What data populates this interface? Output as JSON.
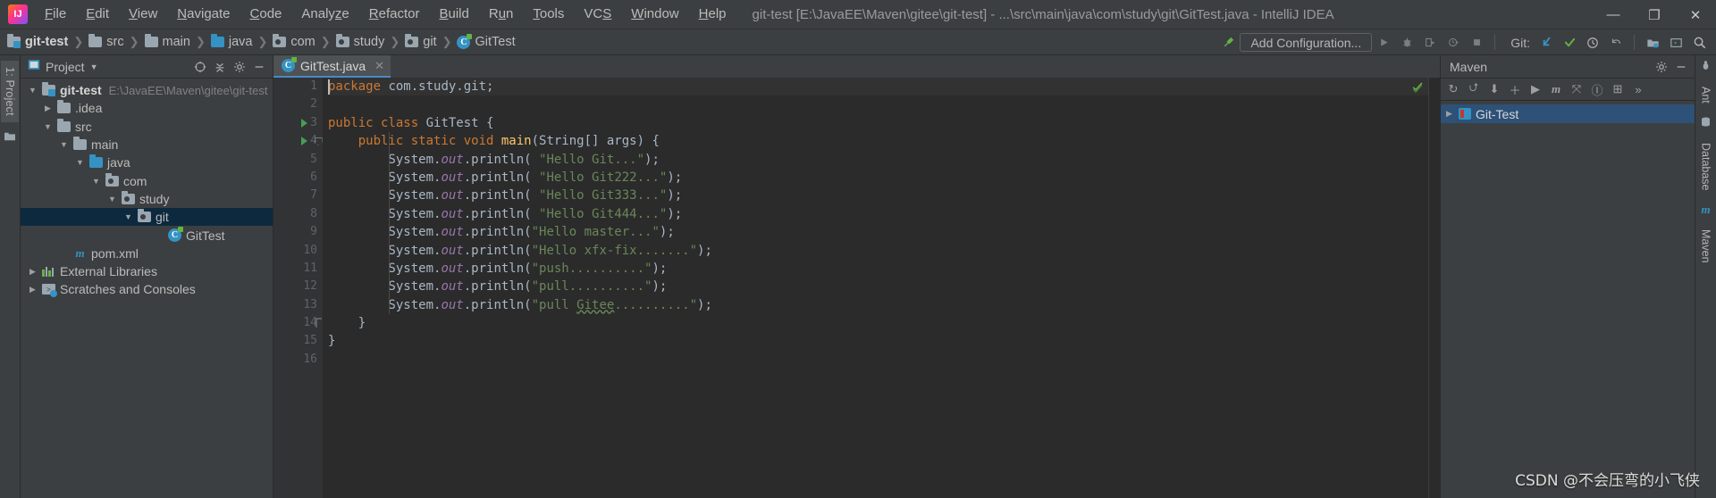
{
  "window": {
    "title": "git-test [E:\\JavaEE\\Maven\\gitee\\git-test] - ...\\src\\main\\java\\com\\study\\git\\GitTest.java - IntelliJ IDEA",
    "logo_text": "IJ",
    "minimize": "—",
    "maximize": "❐",
    "close": "✕"
  },
  "menu": {
    "items": [
      {
        "label": "File"
      },
      {
        "label": "Edit"
      },
      {
        "label": "View"
      },
      {
        "label": "Navigate"
      },
      {
        "label": "Code"
      },
      {
        "label": "Analyze"
      },
      {
        "label": "Refactor"
      },
      {
        "label": "Build"
      },
      {
        "label": "Run"
      },
      {
        "label": "Tools"
      },
      {
        "label": "VCS"
      },
      {
        "label": "Window"
      },
      {
        "label": "Help"
      }
    ]
  },
  "navbar": {
    "breadcrumbs": [
      {
        "label": "git-test",
        "icon": "module-folder-icon"
      },
      {
        "label": "src",
        "icon": "folder-icon"
      },
      {
        "label": "main",
        "icon": "folder-icon"
      },
      {
        "label": "java",
        "icon": "source-folder-icon"
      },
      {
        "label": "com",
        "icon": "package-icon"
      },
      {
        "label": "study",
        "icon": "package-icon"
      },
      {
        "label": "git",
        "icon": "package-icon"
      },
      {
        "label": "GitTest",
        "icon": "java-class-icon"
      }
    ],
    "separator": "❯",
    "build_icon": "hammer-icon",
    "add_configuration": "Add Configuration...",
    "run_icon": "run-icon",
    "debug_icon": "debug-icon",
    "run_coverage_icon": "run-with-coverage-icon",
    "profile_icon": "profiler-icon",
    "stop_icon": "stop-icon",
    "git_label": "Git:",
    "git_update_icon": "update-project-icon",
    "git_commit_icon": "commit-icon",
    "git_history_icon": "history-icon",
    "git_rollback_icon": "rollback-icon",
    "project_structure_icon": "project-structure-icon",
    "terminal_icon": "terminal-icon",
    "search_icon": "search-everywhere-icon"
  },
  "left_rail": {
    "project_tab": "1: Project",
    "structure_icon": "structure-icon"
  },
  "project_panel": {
    "title": "Project",
    "dropdown_icon": "chevron-down-icon",
    "window_icon": "project-view-icon",
    "locate_icon": "scroll-from-source-icon",
    "collapse_icon": "collapse-all-icon",
    "settings_icon": "gear-icon",
    "hide_icon": "hide-icon",
    "tree": [
      {
        "label": "git-test",
        "hint": "E:\\JavaEE\\Maven\\gitee\\git-test",
        "depth": 0,
        "arrow": "▼",
        "icon": "module-folder-icon",
        "bold": true,
        "selected": false
      },
      {
        "label": ".idea",
        "hint": "",
        "depth": 1,
        "arrow": "▶",
        "icon": "folder-icon",
        "bold": false,
        "selected": false
      },
      {
        "label": "src",
        "hint": "",
        "depth": 1,
        "arrow": "▼",
        "icon": "folder-icon",
        "bold": false,
        "selected": false
      },
      {
        "label": "main",
        "hint": "",
        "depth": 2,
        "arrow": "▼",
        "icon": "folder-icon",
        "bold": false,
        "selected": false
      },
      {
        "label": "java",
        "hint": "",
        "depth": 3,
        "arrow": "▼",
        "icon": "source-folder-icon",
        "bold": false,
        "selected": false
      },
      {
        "label": "com",
        "hint": "",
        "depth": 4,
        "arrow": "▼",
        "icon": "package-icon",
        "bold": false,
        "selected": false
      },
      {
        "label": "study",
        "hint": "",
        "depth": 5,
        "arrow": "▼",
        "icon": "package-icon",
        "bold": false,
        "selected": false
      },
      {
        "label": "git",
        "hint": "",
        "depth": 6,
        "arrow": "▼",
        "icon": "package-icon",
        "bold": false,
        "selected": true
      },
      {
        "label": "GitTest",
        "hint": "",
        "depth": 7,
        "arrow": "",
        "icon": "java-class-icon",
        "bold": false,
        "selected": false
      },
      {
        "label": "pom.xml",
        "hint": "",
        "depth": 2,
        "arrow": "",
        "icon": "maven-file-icon",
        "bold": false,
        "selected": false
      },
      {
        "label": "External Libraries",
        "hint": "",
        "depth": 0,
        "arrow": "▶",
        "icon": "libraries-icon",
        "bold": false,
        "selected": false
      },
      {
        "label": "Scratches and Consoles",
        "hint": "",
        "depth": 0,
        "arrow": "▶",
        "icon": "scratches-icon",
        "bold": false,
        "selected": false
      }
    ]
  },
  "editor": {
    "tab": {
      "label": "GitTest.java",
      "icon": "java-class-icon",
      "close": "✕"
    },
    "inspection_icon": "inspections-ok-icon",
    "lines": [
      {
        "n": "1",
        "mark": "",
        "current": true
      },
      {
        "n": "2",
        "mark": "",
        "current": false
      },
      {
        "n": "3",
        "mark": "run",
        "current": false
      },
      {
        "n": "4",
        "mark": "run-fold",
        "current": false
      },
      {
        "n": "5",
        "mark": "",
        "current": false
      },
      {
        "n": "6",
        "mark": "",
        "current": false
      },
      {
        "n": "7",
        "mark": "",
        "current": false
      },
      {
        "n": "8",
        "mark": "",
        "current": false
      },
      {
        "n": "9",
        "mark": "",
        "current": false
      },
      {
        "n": "10",
        "mark": "",
        "current": false
      },
      {
        "n": "11",
        "mark": "",
        "current": false
      },
      {
        "n": "12",
        "mark": "",
        "current": false
      },
      {
        "n": "13",
        "mark": "",
        "current": false
      },
      {
        "n": "14",
        "mark": "fold-end",
        "current": false
      },
      {
        "n": "15",
        "mark": "",
        "current": false
      },
      {
        "n": "16",
        "mark": "",
        "current": false
      }
    ],
    "code_text": [
      "package com.study.git;",
      "",
      "public class GitTest {",
      "    public static void main(String[] args) {",
      "        System.out.println( \"Hello Git...\");",
      "        System.out.println( \"Hello Git222...\");",
      "        System.out.println( \"Hello Git333...\");",
      "        System.out.println( \"Hello Git444...\");",
      "        System.out.println(\"Hello master...\");",
      "        System.out.println(\"Hello xfx-fix.......\");",
      "        System.out.println(\"push..........\");",
      "        System.out.println(\"pull..........\");",
      "        System.out.println(\"pull Gitee..........\");",
      "    }",
      "}",
      ""
    ]
  },
  "maven_panel": {
    "title": "Maven",
    "settings_icon": "gear-icon",
    "hide_icon": "hide-icon",
    "toolbar_icons": [
      {
        "name": "reload-all-maven-projects-icon",
        "glyph": "↻"
      },
      {
        "name": "generate-sources-icon",
        "glyph": "⮍"
      },
      {
        "name": "download-sources-icon",
        "glyph": "⬇"
      },
      {
        "name": "add-maven-project-icon",
        "glyph": "＋"
      },
      {
        "name": "run-maven-build-icon",
        "glyph": "▶"
      },
      {
        "name": "execute-maven-goal-icon",
        "glyph": "m"
      },
      {
        "name": "toggle-offline-mode-icon",
        "glyph": "⤧"
      },
      {
        "name": "toggle-skip-tests-icon",
        "glyph": "Ⓘ"
      },
      {
        "name": "show-diagram-icon",
        "glyph": "⊞"
      },
      {
        "name": "more-icon",
        "glyph": "»"
      }
    ],
    "tree": [
      {
        "label": "Git-Test",
        "arrow": "▶",
        "icon": "maven-project-icon",
        "selected": true
      }
    ]
  },
  "right_rail": {
    "tabs": [
      {
        "label": "Ant",
        "icon": "ant-icon"
      },
      {
        "label": "Database",
        "icon": "database-icon"
      },
      {
        "label": "Maven",
        "icon": "maven-icon"
      }
    ]
  },
  "watermark": {
    "text": "CSDN @不会压弯的小飞侠"
  },
  "colors": {
    "accent": "#3592c4",
    "selection": "#0d293e",
    "maven_selection": "#2d5177",
    "keyword": "#cc7832",
    "string": "#6a8759",
    "method": "#ffc66d",
    "static_field": "#9876aa",
    "editor_bg": "#2b2b2b",
    "panel_bg": "#3c3f41",
    "run_green": "#499c54"
  }
}
